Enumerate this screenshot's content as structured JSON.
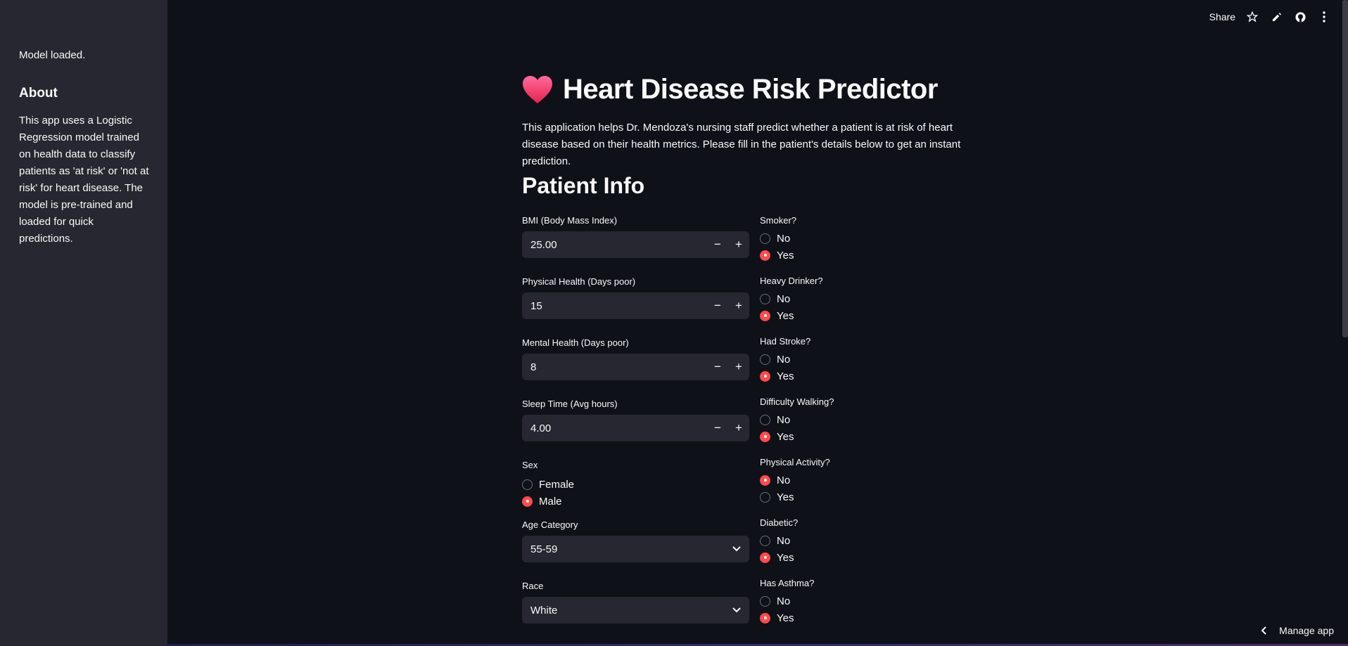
{
  "sidebar": {
    "status": "Model loaded.",
    "about_title": "About",
    "about_text": "This app uses a Logistic Regression model trained on health data to classify patients as 'at risk' or 'not at risk' for heart disease. The model is pre-trained and loaded for quick predictions."
  },
  "topbar": {
    "share_label": "Share",
    "icons": [
      "star-icon",
      "pencil-icon",
      "github-icon",
      "kebab-menu-icon"
    ]
  },
  "header": {
    "title": "Heart Disease Risk Predictor",
    "intro": "This application helps Dr. Mendoza's nursing staff predict whether a patient is at risk of heart disease based on their health metrics. Please fill in the patient's details below to get an instant prediction.",
    "section_title": "Patient Info"
  },
  "form": {
    "bmi": {
      "label": "BMI (Body Mass Index)",
      "value": "25.00"
    },
    "physical_health": {
      "label": "Physical Health (Days poor)",
      "value": "15"
    },
    "mental_health": {
      "label": "Mental Health (Days poor)",
      "value": "8"
    },
    "sleep_time": {
      "label": "Sleep Time (Avg hours)",
      "value": "4.00"
    },
    "sex": {
      "label": "Sex",
      "options": [
        "Female",
        "Male"
      ],
      "selected": "Male"
    },
    "age_category": {
      "label": "Age Category",
      "value": "55-59"
    },
    "race": {
      "label": "Race",
      "value": "White"
    },
    "smoker": {
      "label": "Smoker?",
      "options": [
        "No",
        "Yes"
      ],
      "selected": "Yes"
    },
    "heavy_drinker": {
      "label": "Heavy Drinker?",
      "options": [
        "No",
        "Yes"
      ],
      "selected": "Yes"
    },
    "had_stroke": {
      "label": "Had Stroke?",
      "options": [
        "No",
        "Yes"
      ],
      "selected": "Yes"
    },
    "difficulty_walking": {
      "label": "Difficulty Walking?",
      "options": [
        "No",
        "Yes"
      ],
      "selected": "Yes"
    },
    "physical_activity": {
      "label": "Physical Activity?",
      "options": [
        "No",
        "Yes"
      ],
      "selected": "No"
    },
    "diabetic": {
      "label": "Diabetic?",
      "options": [
        "No",
        "Yes"
      ],
      "selected": "Yes"
    },
    "has_asthma": {
      "label": "Has Asthma?",
      "options": [
        "No",
        "Yes"
      ],
      "selected": "Yes"
    }
  },
  "stepper": {
    "minus": "−",
    "plus": "+"
  },
  "footer": {
    "manage_label": "Manage app"
  },
  "colors": {
    "accent": "#ff4b4b",
    "background": "#0e1117",
    "sidebar": "#262730"
  }
}
